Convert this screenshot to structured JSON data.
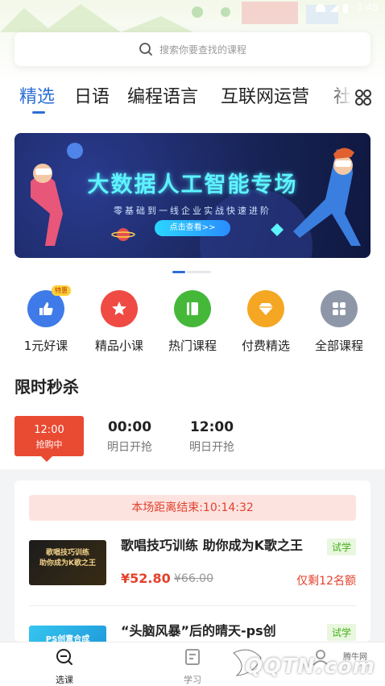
{
  "status_bar": {
    "time": "1:45"
  },
  "search": {
    "placeholder": "搜索你要查找的课程"
  },
  "tabs": [
    {
      "label": "精选",
      "active": true
    },
    {
      "label": "日语",
      "active": false
    },
    {
      "label": "编程语言",
      "active": false
    },
    {
      "label": "互联网运营",
      "active": false
    },
    {
      "label": "社",
      "active": false
    }
  ],
  "banner": {
    "title": "大数据人工智能专场",
    "subtitle": "零基础到一线企业实战快速进阶",
    "button": "点击查看>>"
  },
  "quick_entries": [
    {
      "label": "1元好课",
      "icon": "thumbs-up-icon",
      "color": "#3f7be8",
      "tag": "特惠"
    },
    {
      "label": "精品小课",
      "icon": "star-icon",
      "color": "#ef4a43"
    },
    {
      "label": "热门课程",
      "icon": "book-icon",
      "color": "#45b83a"
    },
    {
      "label": "付费精选",
      "icon": "diamond-icon",
      "color": "#f5a623"
    },
    {
      "label": "全部课程",
      "icon": "apps-icon",
      "color": "#8e97a8"
    }
  ],
  "flash_sale": {
    "title": "限时秒杀",
    "slots": [
      {
        "time": "12:00",
        "status": "抢购中",
        "active": true
      },
      {
        "time": "00:00",
        "status": "明日开抢",
        "active": false
      },
      {
        "time": "12:00",
        "status": "明日开抢",
        "active": false
      }
    ],
    "countdown": "本场距离结束:10:14:32",
    "courses": [
      {
        "title": "歌唱技巧训练 助你成为K歌之王",
        "thumb_text": "歌唱技巧训练\n助你成为K歌之王",
        "trial": "试学",
        "price": "¥52.80",
        "original_price": "¥66.00",
        "remaining": "仅剩12名额"
      },
      {
        "title": "“头脑风暴”后的晴天-ps创",
        "thumb_text": "PS创意合成",
        "trial": "试学"
      }
    ]
  },
  "bottom_nav": [
    {
      "label": "选课",
      "icon": "search-course-icon",
      "active": true
    },
    {
      "label": "学习",
      "icon": "study-icon",
      "active": false
    },
    {
      "label": "",
      "icon": "profile-icon",
      "active": false
    }
  ],
  "watermark": {
    "text": "QQTN.com",
    "small": "腾牛网"
  },
  "colors": {
    "accent": "#2c6fd7",
    "sale": "#e94a32",
    "trial_green": "#43b11a"
  }
}
